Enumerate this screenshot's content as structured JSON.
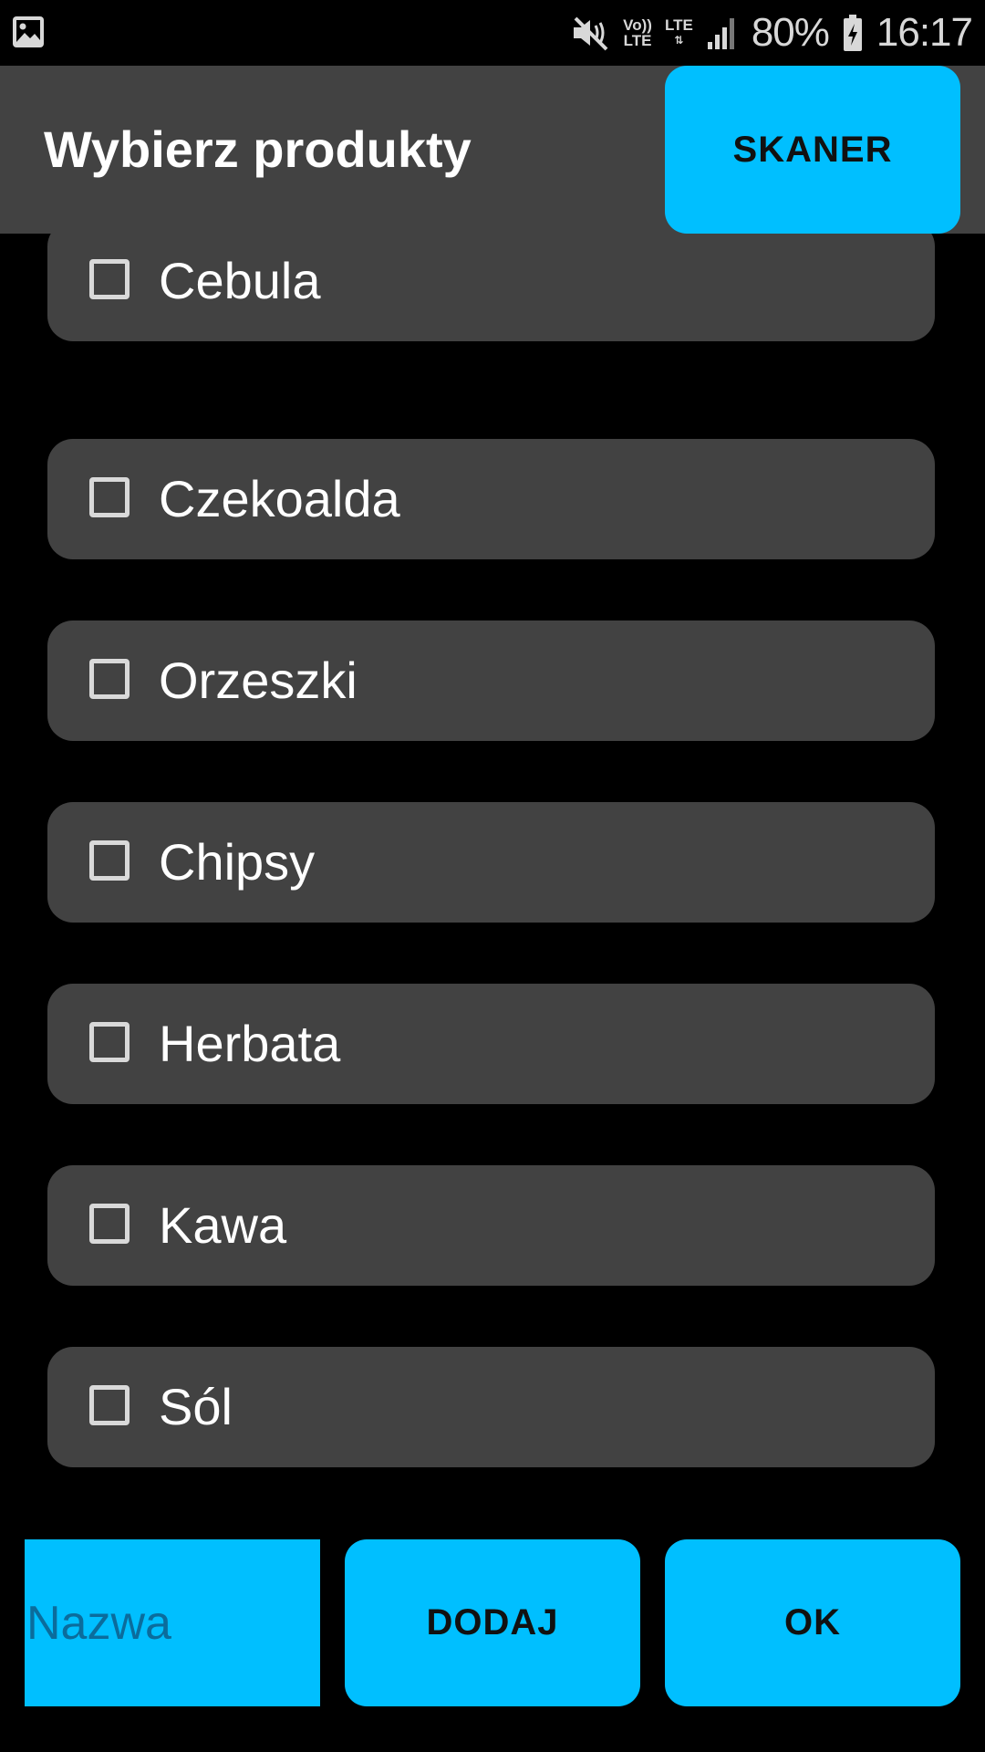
{
  "status_bar": {
    "left_icon": "gallery-icon",
    "volte_line1": "Vo))",
    "volte_line2": "LTE",
    "lte_label": "LTE",
    "battery_text": "80%",
    "time": "16:17",
    "icons": [
      "mute-icon",
      "volte-icon",
      "lte-icon",
      "signal-icon",
      "battery-charging-icon"
    ]
  },
  "header": {
    "title": "Wybierz produkty",
    "scanner_label": "SKANER"
  },
  "products": [
    {
      "label": "Cebula",
      "checked": false
    },
    {
      "label": "Czekoalda",
      "checked": false
    },
    {
      "label": "Orzeszki",
      "checked": false
    },
    {
      "label": "Chipsy",
      "checked": false
    },
    {
      "label": "Herbata",
      "checked": false
    },
    {
      "label": "Kawa",
      "checked": false
    },
    {
      "label": "Sól",
      "checked": false
    }
  ],
  "bottom": {
    "name_placeholder": "Nazwa",
    "name_value": "",
    "add_label": "DODAJ",
    "ok_label": "OK"
  },
  "colors": {
    "accent": "#00bfff",
    "surface": "#424242",
    "background": "#000000"
  }
}
